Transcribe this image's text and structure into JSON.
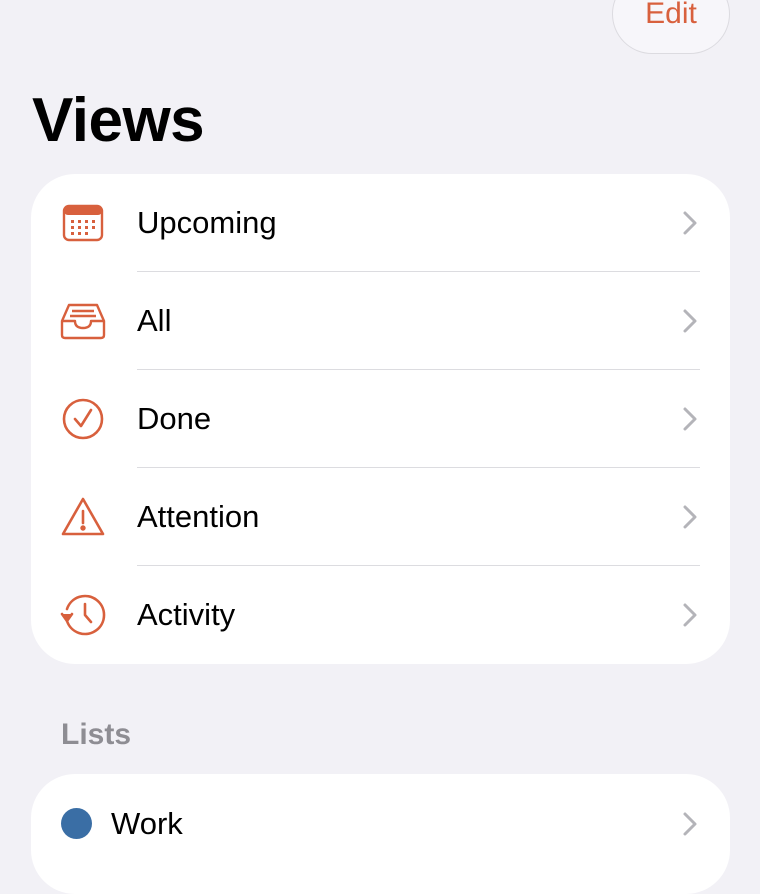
{
  "header": {
    "edit_label": "Edit",
    "title": "Views"
  },
  "views": {
    "items": [
      {
        "label": "Upcoming",
        "icon": "calendar-icon"
      },
      {
        "label": "All",
        "icon": "tray-icon"
      },
      {
        "label": "Done",
        "icon": "checkmark-circle-icon"
      },
      {
        "label": "Attention",
        "icon": "warning-triangle-icon"
      },
      {
        "label": "Activity",
        "icon": "clock-history-icon"
      }
    ]
  },
  "lists": {
    "header": "Lists",
    "items": [
      {
        "label": "Work",
        "color": "#3A6EA5"
      }
    ]
  },
  "colors": {
    "accent": "#D8603D",
    "background": "#F2F1F6",
    "card": "#FFFFFF",
    "chevron": "#B4B4B9",
    "section_header": "#8E8D93"
  }
}
